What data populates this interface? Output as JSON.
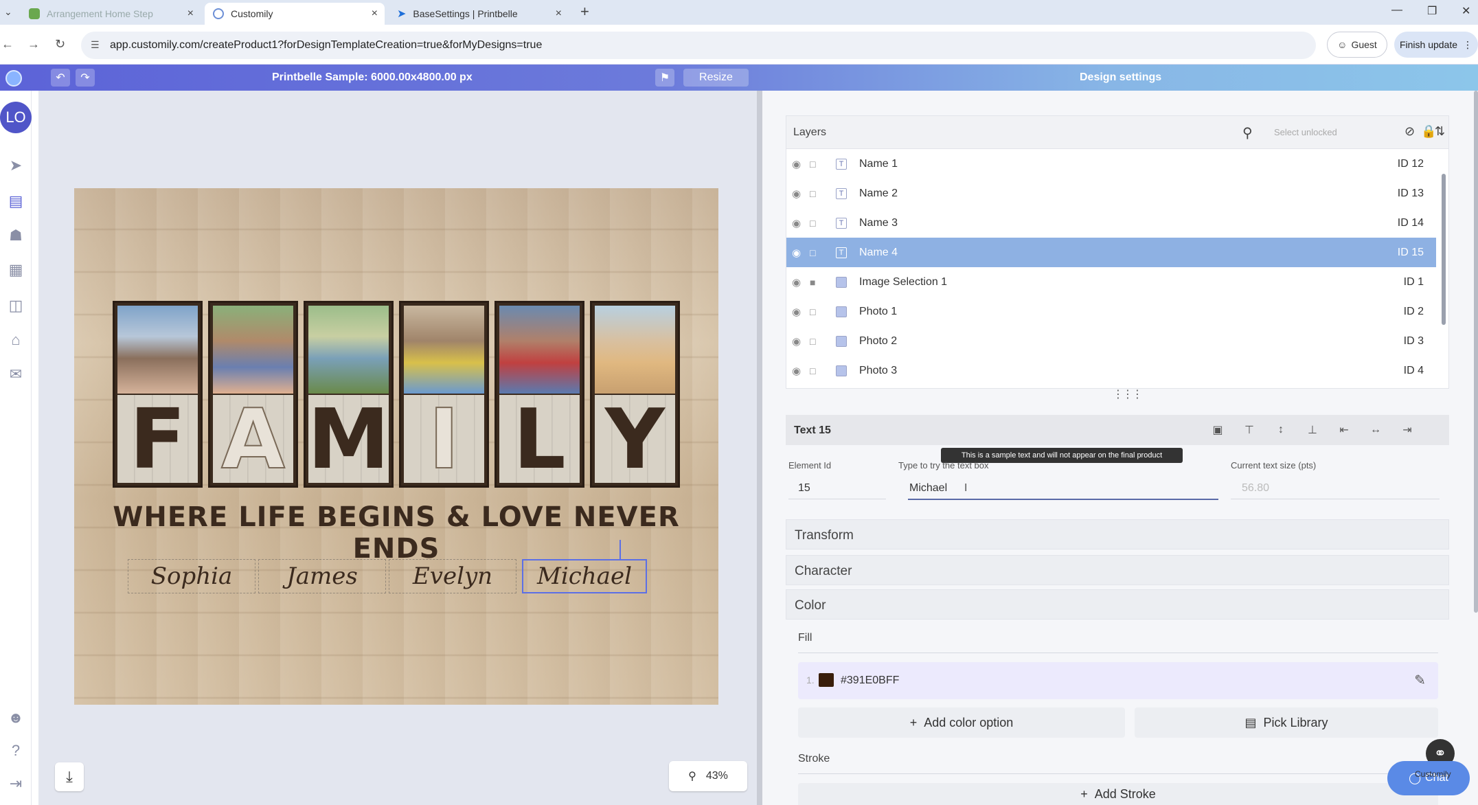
{
  "browser": {
    "tabs": [
      {
        "label": "Arrangement Home Step"
      },
      {
        "label": "Customily"
      },
      {
        "label": "BaseSettings | Printbelle"
      }
    ],
    "url": "app.customily.com/createProduct1?forDesignTemplateCreation=true&forMyDesigns=true",
    "guest_label": "Guest",
    "finish_update_label": "Finish update"
  },
  "app": {
    "canvas_title": "Printbelle Sample: 6000.00x4800.00 px",
    "resize_label": "Resize",
    "panel_title": "Design settings",
    "avatar_initials": "LO"
  },
  "design": {
    "letters": [
      "F",
      "A",
      "M",
      "I",
      "L",
      "Y"
    ],
    "tagline": "WHERE LIFE BEGINS & LOVE NEVER ENDS",
    "names": [
      "Sophia",
      "James",
      "Evelyn",
      "Michael"
    ]
  },
  "canvas_controls": {
    "zoom_label": "43%"
  },
  "layers": {
    "title": "Layers",
    "search_placeholder": "Select unlocked",
    "items": [
      {
        "name": "Name 1",
        "id": "ID 12",
        "kind": "text"
      },
      {
        "name": "Name 2",
        "id": "ID 13",
        "kind": "text"
      },
      {
        "name": "Name 3",
        "id": "ID 14",
        "kind": "text"
      },
      {
        "name": "Name 4",
        "id": "ID 15",
        "kind": "text",
        "selected": true
      },
      {
        "name": "Image Selection 1",
        "id": "ID 1",
        "kind": "image",
        "locked": true
      },
      {
        "name": "Photo 1",
        "id": "ID 2",
        "kind": "image"
      },
      {
        "name": "Photo 2",
        "id": "ID 3",
        "kind": "image"
      },
      {
        "name": "Photo 3",
        "id": "ID 4",
        "kind": "image"
      }
    ]
  },
  "text_section": {
    "title": "Text 15",
    "tooltip": "This is a sample text and will not appear on the final product",
    "element_id_label": "Element Id",
    "element_id_value": "15",
    "sample_label": "Type to try the text box",
    "sample_value": "Michael",
    "size_label": "Current text size (pts)",
    "size_value": "56.80"
  },
  "accordions": {
    "transform": "Transform",
    "character": "Character",
    "color": "Color"
  },
  "color": {
    "fill_label": "Fill",
    "fill_index": "1.",
    "fill_hex": "#391E0BFF",
    "add_color_label": "Add color option",
    "pick_library_label": "Pick Library",
    "stroke_label": "Stroke",
    "add_stroke_label": "Add Stroke"
  },
  "chat": {
    "brand": "Customily",
    "label": "Chat"
  },
  "colors": {
    "accent": "#5b63d6",
    "selected_layer": "#8eb1e3",
    "fill_swatch": "#391E0B"
  }
}
